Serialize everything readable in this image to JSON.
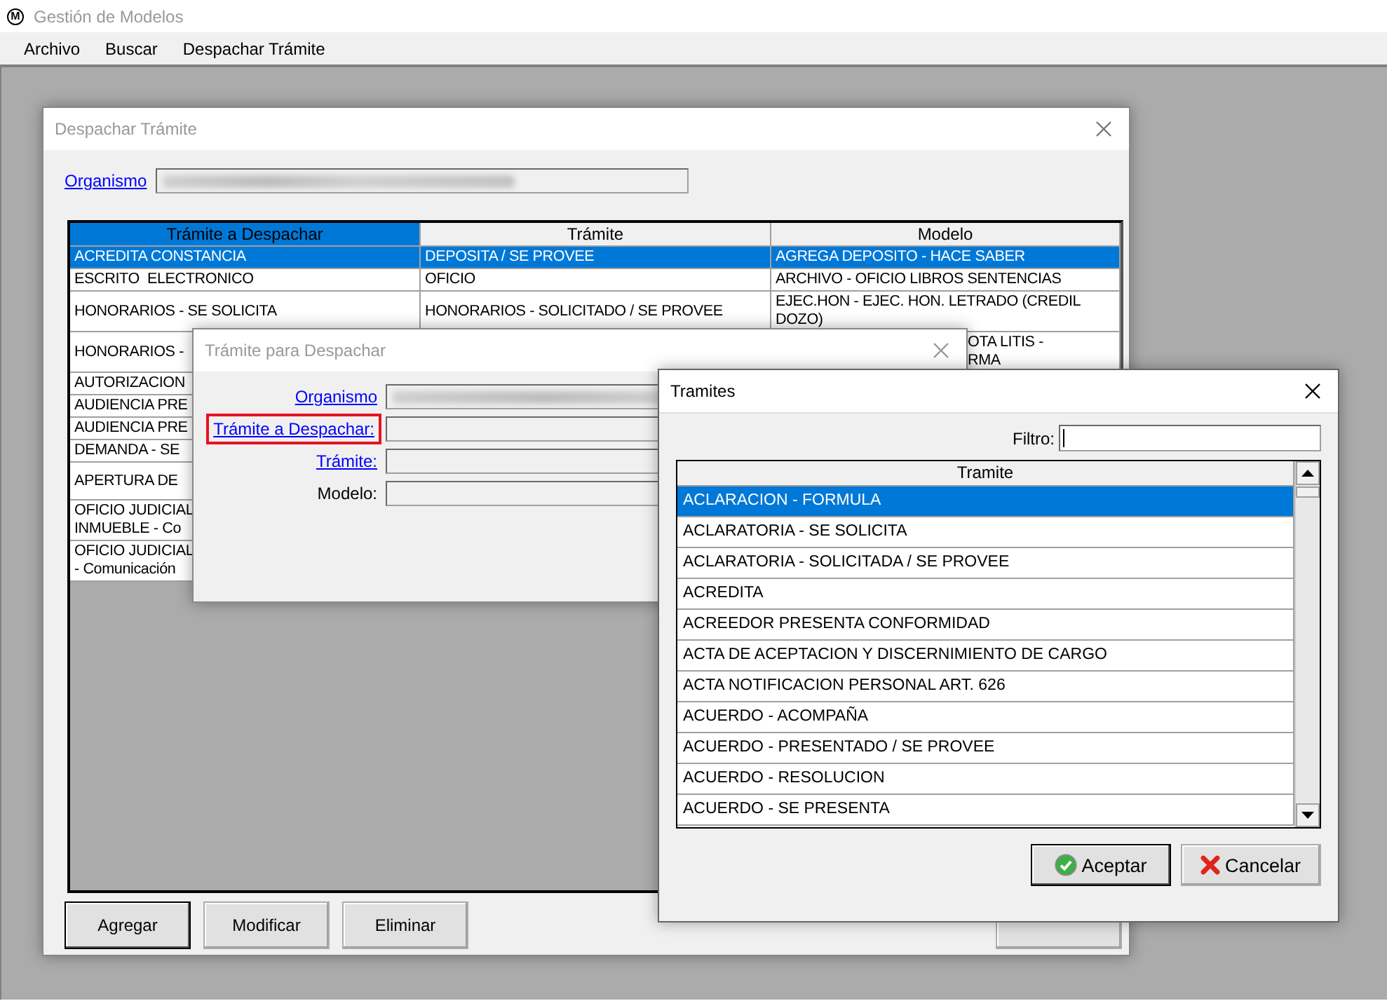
{
  "app": {
    "icon_letter": "M",
    "title": "Gestión de Modelos"
  },
  "menu": [
    {
      "label": "Archivo"
    },
    {
      "label": "Buscar"
    },
    {
      "label": "Despachar Trámite"
    }
  ],
  "main_dialog": {
    "title": "Despachar Trámite",
    "organismo_link": "Organismo",
    "table": {
      "columns": [
        {
          "label": "Trámite a Despachar",
          "selected": true
        },
        {
          "label": "Trámite",
          "selected": false
        },
        {
          "label": "Modelo",
          "selected": false
        }
      ],
      "rows": [
        {
          "selected": true,
          "tramite_a_despachar": "ACREDITA CONSTANCIA",
          "tramite": "DEPOSITA / SE PROVEE",
          "modelo": "AGREGA DEPOSITO - HACE SABER"
        },
        {
          "selected": false,
          "tramite_a_despachar": "ESCRITO  ELECTRONICO",
          "tramite": "OFICIO",
          "modelo": "ARCHIVO - OFICIO LIBROS SENTENCIAS"
        },
        {
          "selected": false,
          "tramite_a_despachar": "HONORARIOS - SE SOLICITA",
          "tramite": "HONORARIOS - SOLICITADO / SE PROVEE",
          "modelo": "EJEC.HON - EJEC. HON. LETRADO (CREDIL\nDOZO)"
        },
        {
          "selected": false,
          "tramite_a_despachar": "HONORARIOS -",
          "modelo": "OTA LITIS -\nRMA",
          "modelo_starts_hidden": true
        },
        {
          "selected": false,
          "tramite_a_despachar": "AUTORIZACION"
        },
        {
          "selected": false,
          "tramite_a_despachar": "AUDIENCIA PRE"
        },
        {
          "selected": false,
          "tramite_a_despachar": "AUDIENCIA PRE"
        },
        {
          "selected": false,
          "tramite_a_despachar": "DEMANDA - SE"
        },
        {
          "selected": false,
          "tramite_a_despachar": "APERTURA DE",
          "tall": true
        },
        {
          "selected": false,
          "tramite_a_despachar": "OFICIO JUDICIAL\nINMUEBLE - Co"
        },
        {
          "selected": false,
          "tramite_a_despachar": "OFICIO JUDICIAL\n- Comunicación"
        }
      ]
    },
    "buttons": [
      {
        "label": "Agregar",
        "default": true
      },
      {
        "label": "Modificar",
        "default": false
      },
      {
        "label": "Eliminar",
        "default": false
      },
      {
        "default": false
      }
    ]
  },
  "despachar_dialog": {
    "title": "Trámite para Despachar",
    "fields": [
      {
        "label": "Organismo",
        "kind": "link",
        "highlighted": false,
        "redacted": true
      },
      {
        "label": "Trámite a Despachar:",
        "kind": "link",
        "highlighted": true,
        "redacted": false
      },
      {
        "label": "Trámite:",
        "kind": "link",
        "highlighted": false,
        "redacted": false
      },
      {
        "label": "Modelo:",
        "kind": "plain",
        "highlighted": false,
        "redacted": false
      }
    ]
  },
  "tramites_dialog": {
    "title": "Tramites",
    "filter_label": "Filtro:",
    "column": "Tramite",
    "items": [
      {
        "label": "ACLARACION - FORMULA",
        "selected": true
      },
      {
        "label": "ACLARATORIA - SE SOLICITA",
        "selected": false
      },
      {
        "label": "ACLARATORIA - SOLICITADA / SE PROVEE",
        "selected": false
      },
      {
        "label": "ACREDITA",
        "selected": false
      },
      {
        "label": "ACREEDOR PRESENTA CONFORMIDAD",
        "selected": false
      },
      {
        "label": "ACTA DE ACEPTACION Y DISCERNIMIENTO DE CARGO",
        "selected": false
      },
      {
        "label": "ACTA NOTIFICACION PERSONAL ART. 626",
        "selected": false
      },
      {
        "label": "ACUERDO - ACOMPAÑA",
        "selected": false
      },
      {
        "label": "ACUERDO - PRESENTADO  / SE PROVEE",
        "selected": false
      },
      {
        "label": "ACUERDO - RESOLUCION",
        "selected": false
      },
      {
        "label": "ACUERDO - SE PRESENTA",
        "selected": false
      }
    ],
    "buttons": [
      {
        "label": "Aceptar",
        "kind": "accept",
        "default": true
      },
      {
        "label": "Cancelar",
        "kind": "cancel",
        "default": false
      }
    ]
  }
}
